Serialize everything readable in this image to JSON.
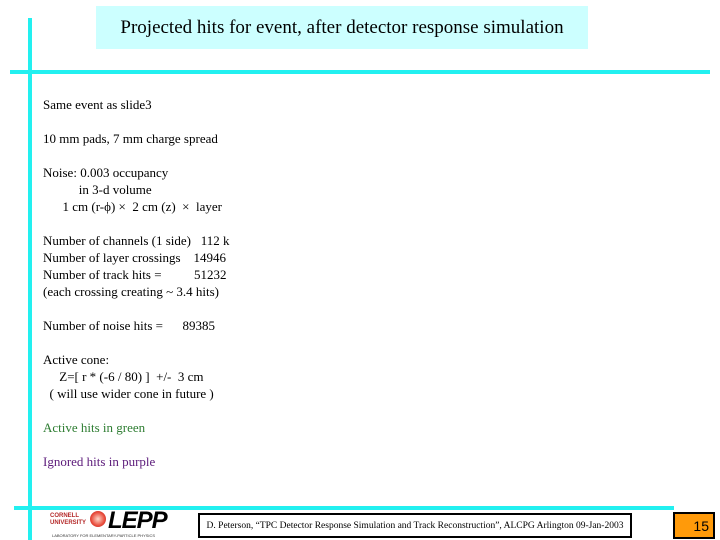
{
  "slide": {
    "title": "Projected hits for event, after detector response simulation",
    "body": {
      "line1": "Same event as slide3",
      "line2": "10 mm pads, 7 mm charge spread",
      "noise_1": "Noise: 0.003 occupancy",
      "noise_2": "           in 3-d volume",
      "noise_3": "      1 cm (r-ϕ) ×  2 cm (z)  ×  layer",
      "channels": "Number of channels (1 side)   112 k",
      "crossings": "Number of layer crossings    14946",
      "track_hits": "Number of track hits =          51232",
      "each_crossing": "(each crossing creating ~ 3.4 hits)",
      "noise_hits": "Number of noise hits =      89385",
      "cone_1": "Active cone:",
      "cone_2": "     Z=[ r * (-6 / 80) ]  +/-  3 cm",
      "cone_3": "  ( will use wider cone in future )",
      "active_hits": "Active hits in green",
      "ignored_hits": "Ignored hits in purple"
    },
    "colors": {
      "accent_lines": "#22f0f0",
      "title_background": "#ccffff",
      "active_hits": "#2e7d32",
      "ignored_hits": "#5b1a7a",
      "page_number_background": "#ff9a0a"
    }
  },
  "logo": {
    "cornell_1": "CORNELL",
    "cornell_2": "UNIVERSITY",
    "name": "LEPP",
    "tagline": "LABORATORY FOR ELEMENTARY-PARTICLE PHYSICS"
  },
  "footer": {
    "citation": "D. Peterson, “TPC Detector Response Simulation and Track Reconstruction”, ALCPG Arlington 09-Jan-2003",
    "page_number": "15"
  }
}
